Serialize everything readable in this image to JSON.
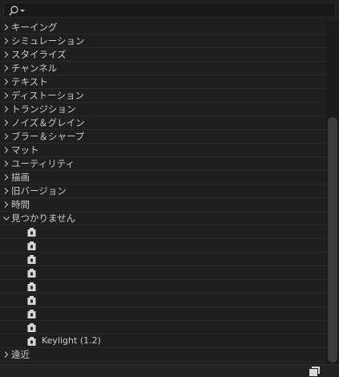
{
  "search": {
    "value": "",
    "placeholder": ""
  },
  "categories_before": [
    {
      "label": "キーイング",
      "expanded": false
    },
    {
      "label": "シミュレーション",
      "expanded": false
    },
    {
      "label": "スタイライズ",
      "expanded": false
    },
    {
      "label": "チャンネル",
      "expanded": false
    },
    {
      "label": "テキスト",
      "expanded": false
    },
    {
      "label": "ディストーション",
      "expanded": false
    },
    {
      "label": "トランジション",
      "expanded": false
    },
    {
      "label": "ノイズ＆グレイン",
      "expanded": false
    },
    {
      "label": "ブラー＆シャープ",
      "expanded": false
    },
    {
      "label": "マット",
      "expanded": false
    },
    {
      "label": "ユーティリティ",
      "expanded": false
    },
    {
      "label": "描画",
      "expanded": false
    },
    {
      "label": "旧バージョン",
      "expanded": false
    },
    {
      "label": "時間",
      "expanded": false
    },
    {
      "label": "見つかりません",
      "expanded": true
    }
  ],
  "missing_items": [
    {
      "label": ""
    },
    {
      "label": ""
    },
    {
      "label": ""
    },
    {
      "label": ""
    },
    {
      "label": ""
    },
    {
      "label": ""
    },
    {
      "label": ""
    },
    {
      "label": ""
    },
    {
      "label": "Keylight (1.2)"
    }
  ],
  "categories_after": [
    {
      "label": "遠近",
      "expanded": false
    }
  ],
  "icons": {
    "search": "search-icon",
    "collapsed": "chevron-right-icon",
    "expanded": "chevron-down-icon",
    "item": "effect-plugin-icon",
    "footer": "new-bin-icon"
  },
  "colors": {
    "background": "#1f1f1f",
    "text": "#cccccc",
    "row_divider": "#2b2b2b"
  }
}
